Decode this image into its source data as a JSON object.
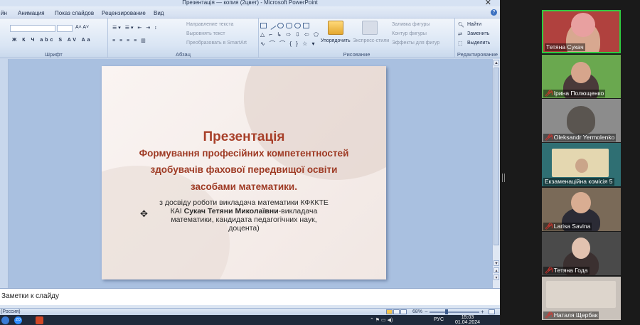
{
  "window": {
    "title": "Презентація — копия (2цвет) - Microsoft PowerPoint",
    "close_glyph": "✕"
  },
  "menu": {
    "items": [
      "йн",
      "Анимация",
      "Показ слайдов",
      "Рецензирование",
      "Вид"
    ],
    "help_glyph": "?"
  },
  "ribbon": {
    "font_group_label": "Шрифт",
    "paragraph_group_label": "Абзац",
    "drawing_group_label": "Рисование",
    "editing_group_label": "Редактирование",
    "text_direction": "Направление текста",
    "align_text": "Выровнять текст",
    "convert_smartart": "Преобразовать в SmartArt",
    "arrange": "Упорядочить",
    "quick_styles": "Экспресс-стили",
    "shape_fill": "Заливка фигуры",
    "shape_outline": "Контур фигуры",
    "shape_effects": "Эффекты для фигур",
    "find": "Найти",
    "replace": "Заменить",
    "select": "Выделить"
  },
  "slide": {
    "title": "Презентація",
    "subtitle_line1": "Формування професійних компетентностей",
    "subtitle_line2": "здобувачів фахової передвищої освіти",
    "subtitle_line3": "засобами математики.",
    "body_line1": "з досвіду роботи викладача математики КФККТЕ",
    "body_line2_prefix": "КАІ ",
    "body_line2_bold": "Сукач Тетяни Миколаївни",
    "body_line2_suffix": "-викладача",
    "body_line3": "математики, кандидата педагогічних наук,",
    "body_line4": "доцента)"
  },
  "notes": {
    "placeholder": "Заметки к слайду"
  },
  "status": {
    "language": "(Россия)",
    "zoom": "68%",
    "zoom_level": 0.68
  },
  "taskbar": {
    "lang": "РУС",
    "time": "15:03",
    "date": "01.04.2024",
    "zoom_badge": "ZO"
  },
  "participants": [
    {
      "name": "Тетяна Сукач",
      "muted": false,
      "active": true,
      "bg": "#b0413e"
    },
    {
      "name": "Ірина Полющенко",
      "muted": true,
      "active": false,
      "bg": "#6aa84f"
    },
    {
      "name": "Oleksandr Yermolenko",
      "muted": true,
      "active": false,
      "bg": "#8c8c8c"
    },
    {
      "name": "Екзаменаційна комісія 5",
      "muted": false,
      "active": false,
      "bg": "#2f6f73"
    },
    {
      "name": "Larisa Savina",
      "muted": true,
      "active": false,
      "bg": "#7a6a58"
    },
    {
      "name": "Тетяна Года",
      "muted": true,
      "active": false,
      "bg": "#4a4a4a"
    },
    {
      "name": "Наталя Щербак",
      "muted": true,
      "active": false,
      "bg": "#c9c2bb"
    }
  ]
}
